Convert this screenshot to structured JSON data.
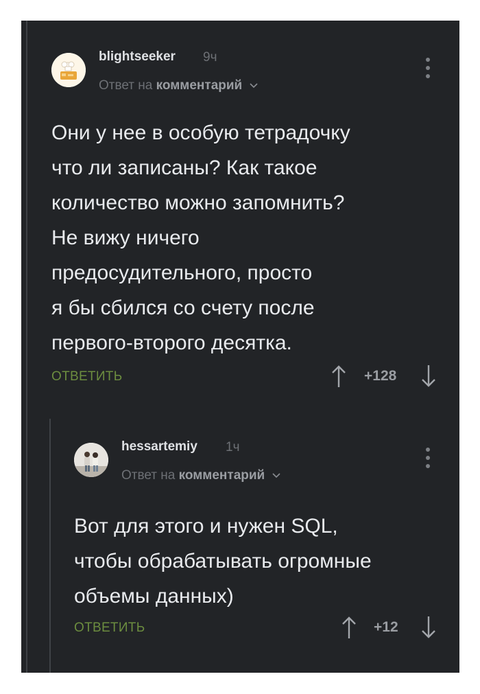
{
  "comments": [
    {
      "username": "blightseeker",
      "time": "9ч",
      "reply_prefix": "Ответ на",
      "reply_target": "комментарий",
      "avatar_icon": "toast-avatar",
      "body_lines": [
        "Они у нее в особую тетрадочку",
        "что ли записаны? Как такое",
        "количество можно запомнить?",
        "Не вижу ничего",
        "предосудительного, просто",
        "я бы сбился со счету после",
        "первого-второго десятка."
      ],
      "reply_label": "ОТВЕТИТЬ",
      "rating": "+128"
    },
    {
      "username": "hessartemiy",
      "time": "1ч",
      "reply_prefix": "Ответ на",
      "reply_target": "комментарий",
      "avatar_icon": "couple-photo-avatar",
      "body_lines": [
        "Вот для этого и нужен SQL,",
        "чтобы обрабатывать огромные",
        "объемы данных)"
      ],
      "reply_label": "ОТВЕТИТЬ",
      "rating": "+12"
    }
  ],
  "colors": {
    "background": "#222427",
    "reply_accent": "#6c8d3f",
    "username": "#dfe1e4",
    "meta": "#6d7075"
  }
}
